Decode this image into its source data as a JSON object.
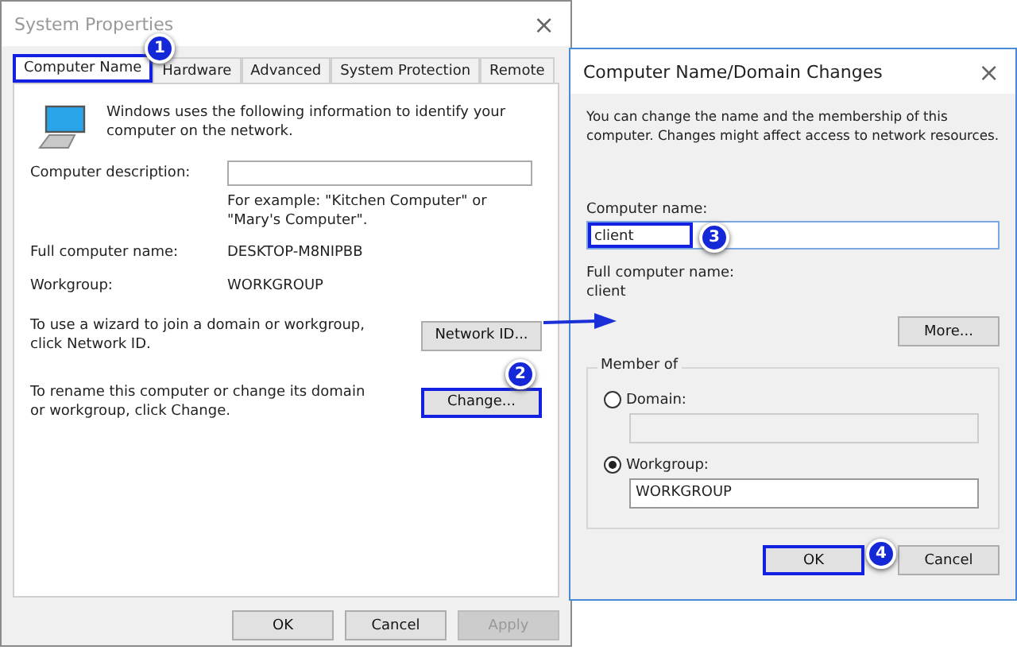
{
  "system_properties": {
    "title": "System Properties",
    "close": "×",
    "tabs": [
      {
        "label": "Computer Name",
        "selected": true,
        "highlighted": true
      },
      {
        "label": "Hardware",
        "selected": false,
        "highlighted": false
      },
      {
        "label": "Advanced",
        "selected": false,
        "highlighted": false
      },
      {
        "label": "System Protection",
        "selected": false,
        "highlighted": false
      },
      {
        "label": "Remote",
        "selected": false,
        "highlighted": false
      }
    ],
    "intro": "Windows uses the following information to identify your computer on the network.",
    "description_label": "Computer description:",
    "description_hint": "For example: \"Kitchen Computer\" or \"Mary's Computer\".",
    "full_name_label": "Full computer name:",
    "full_name": "DESKTOP-M8NIPBB",
    "workgroup_label": "Workgroup:",
    "workgroup": "WORKGROUP",
    "actions": [
      {
        "text": "To use a wizard to join a domain or workgroup, click Network ID.",
        "button": "Network ID...",
        "highlighted": false
      },
      {
        "text": "To rename this computer or change its domain or workgroup, click Change.",
        "button": "Change...",
        "highlighted": true
      }
    ],
    "buttons": [
      {
        "label": "OK",
        "disabled": false
      },
      {
        "label": "Cancel",
        "disabled": false
      },
      {
        "label": "Apply",
        "disabled": true
      }
    ]
  },
  "domain_changes": {
    "title": "Computer Name/Domain Changes",
    "close": "×",
    "intro": "You can change the name and the membership of this computer. Changes might affect access to network resources.",
    "name_label": "Computer name:",
    "name_value": "client",
    "name_highlighted": true,
    "full_name_label": "Full computer name:",
    "full_name": "client",
    "more_button": "More...",
    "group_title": "Member of",
    "members": [
      {
        "label": "Domain:",
        "selected": false
      },
      {
        "label": "Workgroup:",
        "selected": true,
        "value": "WORKGROUP"
      }
    ],
    "buttons": [
      {
        "label": "OK",
        "highlighted": true
      },
      {
        "label": "Cancel",
        "highlighted": false
      }
    ]
  },
  "annotations": [
    {
      "label": "1"
    },
    {
      "label": "2"
    },
    {
      "label": "3"
    },
    {
      "label": "4"
    }
  ]
}
